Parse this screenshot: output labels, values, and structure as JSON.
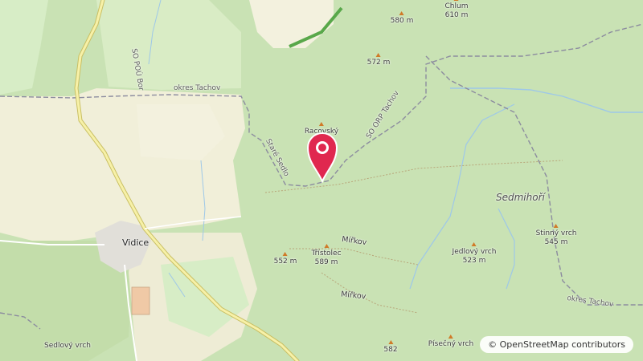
{
  "map": {
    "colors": {
      "forest": "#c7e1b2",
      "field": "#f2f0dd",
      "meadow": "#d5ecc2",
      "village": "#e2e0dc",
      "road": "#f6f0a8",
      "boundary": "#8a8a9c",
      "water": "#9ec8e8",
      "marker": "#e0284f",
      "peak": "#d07a28"
    },
    "peaks": [
      {
        "name": "Chlum",
        "ele": "610 m"
      },
      {
        "name": "",
        "ele": "580 m"
      },
      {
        "name": "",
        "ele": "572 m"
      },
      {
        "name": "Racovský",
        "ele": ""
      },
      {
        "name": "",
        "ele": "552 m"
      },
      {
        "name": "Třístolec",
        "ele": "589 m"
      },
      {
        "name": "Jedlový vrch",
        "ele": "523 m"
      },
      {
        "name": "Stinný vrch",
        "ele": "545 m"
      },
      {
        "name": "",
        "ele": "582"
      },
      {
        "name": "Písečný vrch",
        "ele": ""
      },
      {
        "name": "Sedlový vrch",
        "ele": ""
      }
    ],
    "labels": {
      "vidice": "Vidice",
      "sedmihori": "Sedmihoří",
      "okres_left": "okres Tachov",
      "okres_right": "okres Tachov",
      "so_pou": "SO POÚ Bor",
      "so_orp": "SO ORP Tachov",
      "stare_sedlo": "Staré Sedlo",
      "mirkov_1": "Mířkov",
      "mirkov_2": "Mířkov"
    },
    "attribution": "© OpenStreetMap contributors"
  }
}
